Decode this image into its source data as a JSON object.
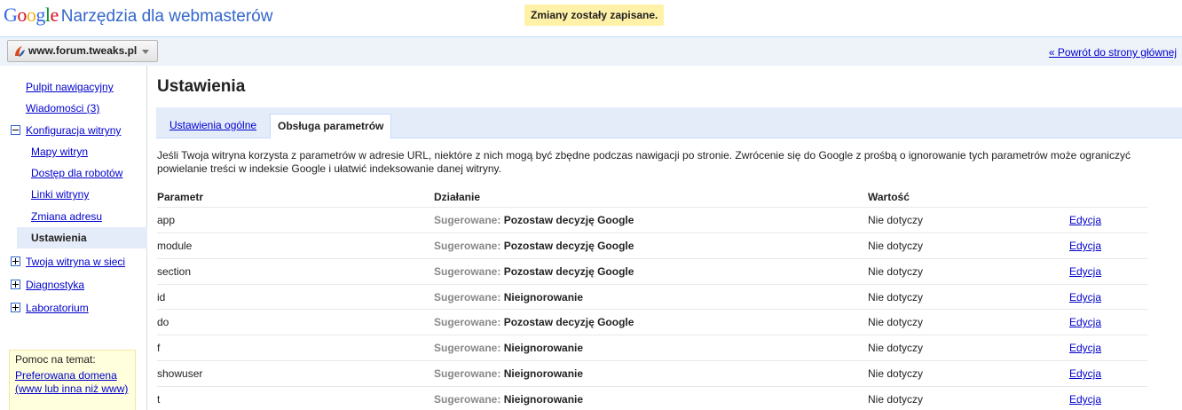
{
  "header": {
    "logo_text": "Google",
    "product_name": "Narzędzia dla webmasterów",
    "flash_message": "Zmiany zostały zapisane."
  },
  "sitebar": {
    "site_name": "www.forum.tweaks.pl",
    "back_link": "« Powrót do strony głównej"
  },
  "sidebar": {
    "dashboard": "Pulpit nawigacyjny",
    "messages": "Wiadomości (3)",
    "site_config": "Konfiguracja witryny",
    "sitemaps": "Mapy witryn",
    "crawler_access": "Dostęp dla robotów",
    "sitelinks": "Linki witryny",
    "change_address": "Zmiana adresu",
    "settings": "Ustawienia",
    "your_site_web": "Twoja witryna w sieci",
    "diagnostics": "Diagnostyka",
    "labs": "Laboratorium"
  },
  "help": {
    "title": "Pomoc na temat:",
    "link": "Preferowana domena (www lub inna niż www)"
  },
  "main": {
    "title": "Ustawienia",
    "tab_general": "Ustawienia ogólne",
    "tab_params": "Obsługa parametrów",
    "description": "Jeśli Twoja witryna korzysta z parametrów w adresie URL, niektóre z nich mogą być zbędne podczas nawigacji po stronie. Zwrócenie się do Google z prośbą o ignorowanie tych parametrów może ograniczyć powielanie treści w indeksie Google i ułatwić indeksowanie danej witryny.",
    "table": {
      "headers": [
        "Parametr",
        "Działanie",
        "Wartość"
      ],
      "rows": [
        {
          "param": "app",
          "action_label": "Sugerowane:",
          "action": "Pozostaw decyzję Google",
          "value": "Nie dotyczy",
          "edit": "Edycja"
        },
        {
          "param": "module",
          "action_label": "Sugerowane:",
          "action": "Pozostaw decyzję Google",
          "value": "Nie dotyczy",
          "edit": "Edycja"
        },
        {
          "param": "section",
          "action_label": "Sugerowane:",
          "action": "Pozostaw decyzję Google",
          "value": "Nie dotyczy",
          "edit": "Edycja"
        },
        {
          "param": "id",
          "action_label": "Sugerowane:",
          "action": "Nieignorowanie",
          "value": "Nie dotyczy",
          "edit": "Edycja"
        },
        {
          "param": "do",
          "action_label": "Sugerowane:",
          "action": "Pozostaw decyzję Google",
          "value": "Nie dotyczy",
          "edit": "Edycja"
        },
        {
          "param": "f",
          "action_label": "Sugerowane:",
          "action": "Nieignorowanie",
          "value": "Nie dotyczy",
          "edit": "Edycja"
        },
        {
          "param": "showuser",
          "action_label": "Sugerowane:",
          "action": "Nieignorowanie",
          "value": "Nie dotyczy",
          "edit": "Edycja"
        },
        {
          "param": "t",
          "action_label": "Sugerowane:",
          "action": "Nieignorowanie",
          "value": "Nie dotyczy",
          "edit": "Edycja"
        }
      ]
    }
  }
}
